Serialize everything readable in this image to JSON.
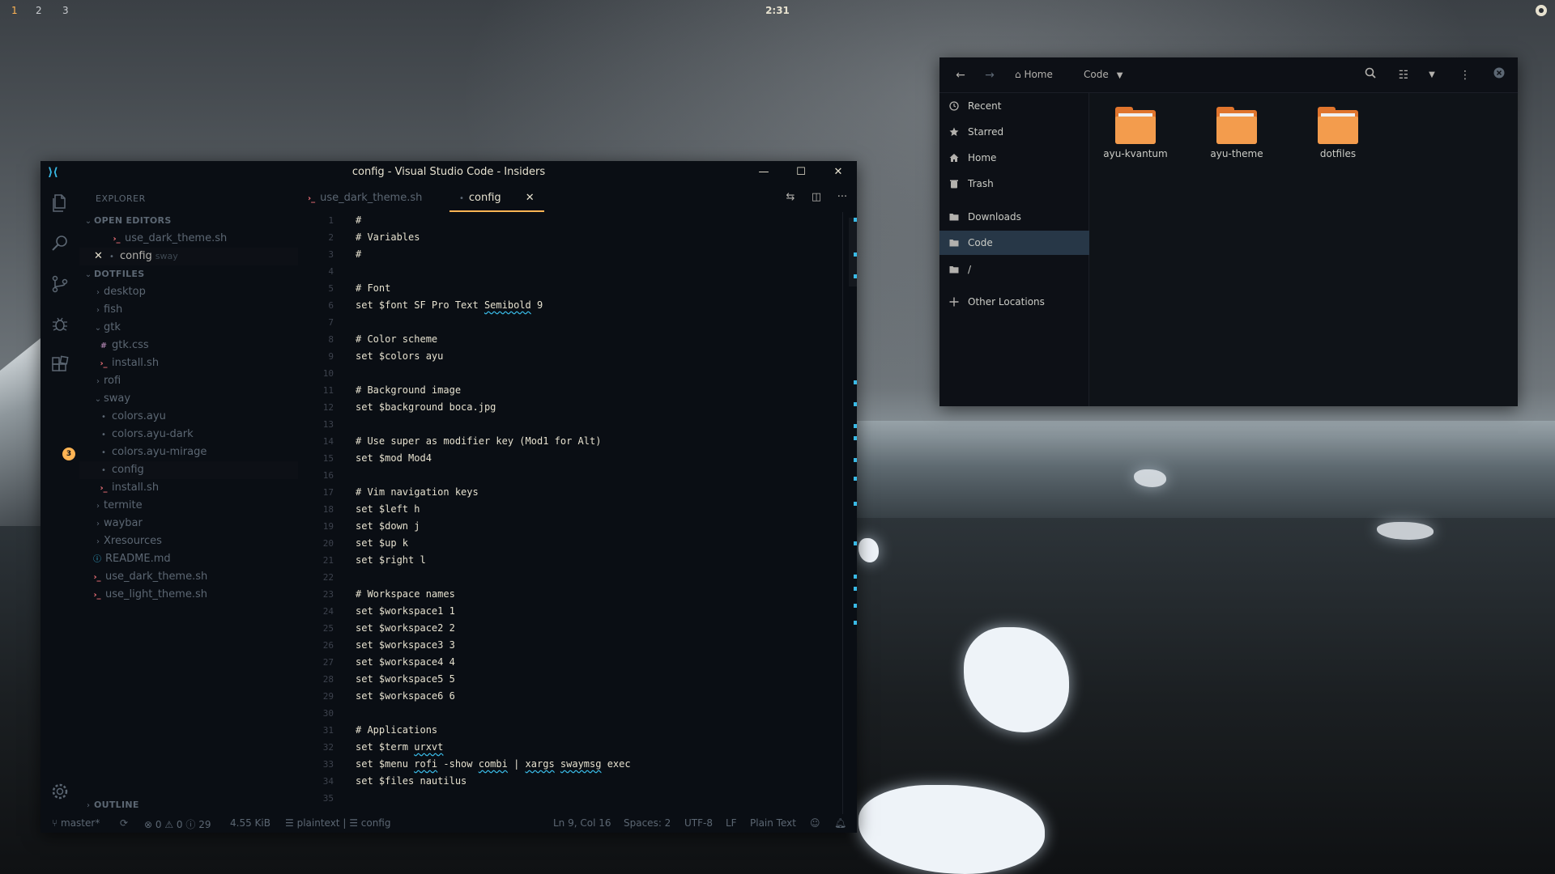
{
  "topbar": {
    "workspaces": [
      "1",
      "2",
      "3"
    ],
    "clock": "2:31"
  },
  "vscode": {
    "title": "config - Visual Studio Code - Insiders",
    "explorer_header": "EXPLORER",
    "open_editors_label": "OPEN EDITORS",
    "open_editors": [
      {
        "name": "use_dark_theme.sh",
        "sub": ""
      },
      {
        "name": "config",
        "sub": "sway"
      }
    ],
    "folder_label": "DOTFILES",
    "tree": [
      {
        "name": "desktop"
      },
      {
        "name": "fish"
      },
      {
        "name": "gtk"
      },
      {
        "name": "gtk.css"
      },
      {
        "name": "install.sh"
      },
      {
        "name": "rofi"
      },
      {
        "name": "sway"
      },
      {
        "name": "colors.ayu"
      },
      {
        "name": "colors.ayu-dark"
      },
      {
        "name": "colors.ayu-mirage"
      },
      {
        "name": "config"
      },
      {
        "name": "install.sh"
      },
      {
        "name": "termite"
      },
      {
        "name": "waybar"
      },
      {
        "name": "Xresources"
      },
      {
        "name": "README.md"
      },
      {
        "name": "use_dark_theme.sh"
      },
      {
        "name": "use_light_theme.sh"
      }
    ],
    "outline_label": "OUTLINE",
    "scm_badge": "3",
    "tabs": [
      {
        "label": "use_dark_theme.sh"
      },
      {
        "label": "config"
      }
    ],
    "lines": [
      {
        "n": "1",
        "t": "#"
      },
      {
        "n": "2",
        "t": "# Variables"
      },
      {
        "n": "3",
        "t": "#"
      },
      {
        "n": "4",
        "t": ""
      },
      {
        "n": "5",
        "t": "# Font"
      },
      {
        "n": "6",
        "t": "set $font SF Pro Text Semibold 9"
      },
      {
        "n": "7",
        "t": ""
      },
      {
        "n": "8",
        "t": "# Color scheme"
      },
      {
        "n": "9",
        "t": "set $colors ayu"
      },
      {
        "n": "10",
        "t": ""
      },
      {
        "n": "11",
        "t": "# Background image"
      },
      {
        "n": "12",
        "t": "set $background boca.jpg"
      },
      {
        "n": "13",
        "t": ""
      },
      {
        "n": "14",
        "t": "# Use super as modifier key (Mod1 for Alt)"
      },
      {
        "n": "15",
        "t": "set $mod Mod4"
      },
      {
        "n": "16",
        "t": ""
      },
      {
        "n": "17",
        "t": "# Vim navigation keys"
      },
      {
        "n": "18",
        "t": "set $left h"
      },
      {
        "n": "19",
        "t": "set $down j"
      },
      {
        "n": "20",
        "t": "set $up k"
      },
      {
        "n": "21",
        "t": "set $right l"
      },
      {
        "n": "22",
        "t": ""
      },
      {
        "n": "23",
        "t": "# Workspace names"
      },
      {
        "n": "24",
        "t": "set $workspace1 1"
      },
      {
        "n": "25",
        "t": "set $workspace2 2"
      },
      {
        "n": "26",
        "t": "set $workspace3 3"
      },
      {
        "n": "27",
        "t": "set $workspace4 4"
      },
      {
        "n": "28",
        "t": "set $workspace5 5"
      },
      {
        "n": "29",
        "t": "set $workspace6 6"
      },
      {
        "n": "30",
        "t": ""
      },
      {
        "n": "31",
        "t": "# Applications"
      },
      {
        "n": "32",
        "t": "set $term urxvt"
      },
      {
        "n": "33",
        "t": "set $menu rofi -show combi | xargs swaymsg exec"
      },
      {
        "n": "34",
        "t": "set $files nautilus"
      },
      {
        "n": "35",
        "t": ""
      }
    ],
    "status": {
      "branch": "master*",
      "errors": "0",
      "warnings": "0",
      "infos": "29",
      "size": "4.55 KiB",
      "lang_mode": "plaintext | ",
      "symbol": "config",
      "position": "Ln 9, Col 16",
      "spaces": "Spaces: 2",
      "encoding": "UTF-8",
      "eol": "LF",
      "language": "Plain Text"
    }
  },
  "files": {
    "breadcrumb_home": "Home",
    "breadcrumb_current": "Code",
    "sidebar": [
      {
        "label": "Recent"
      },
      {
        "label": "Starred"
      },
      {
        "label": "Home"
      },
      {
        "label": "Trash"
      },
      {
        "label": "Downloads"
      },
      {
        "label": "Code"
      },
      {
        "label": "/"
      },
      {
        "label": "Other Locations"
      }
    ],
    "folders": [
      {
        "name": "ayu-kvantum"
      },
      {
        "name": "ayu-theme"
      },
      {
        "name": "dotfiles"
      }
    ]
  },
  "colors": {
    "accent": "#ffb454",
    "editor_bg": "#0a0e14",
    "selection": "#273747",
    "folder": "#f39c4d"
  }
}
